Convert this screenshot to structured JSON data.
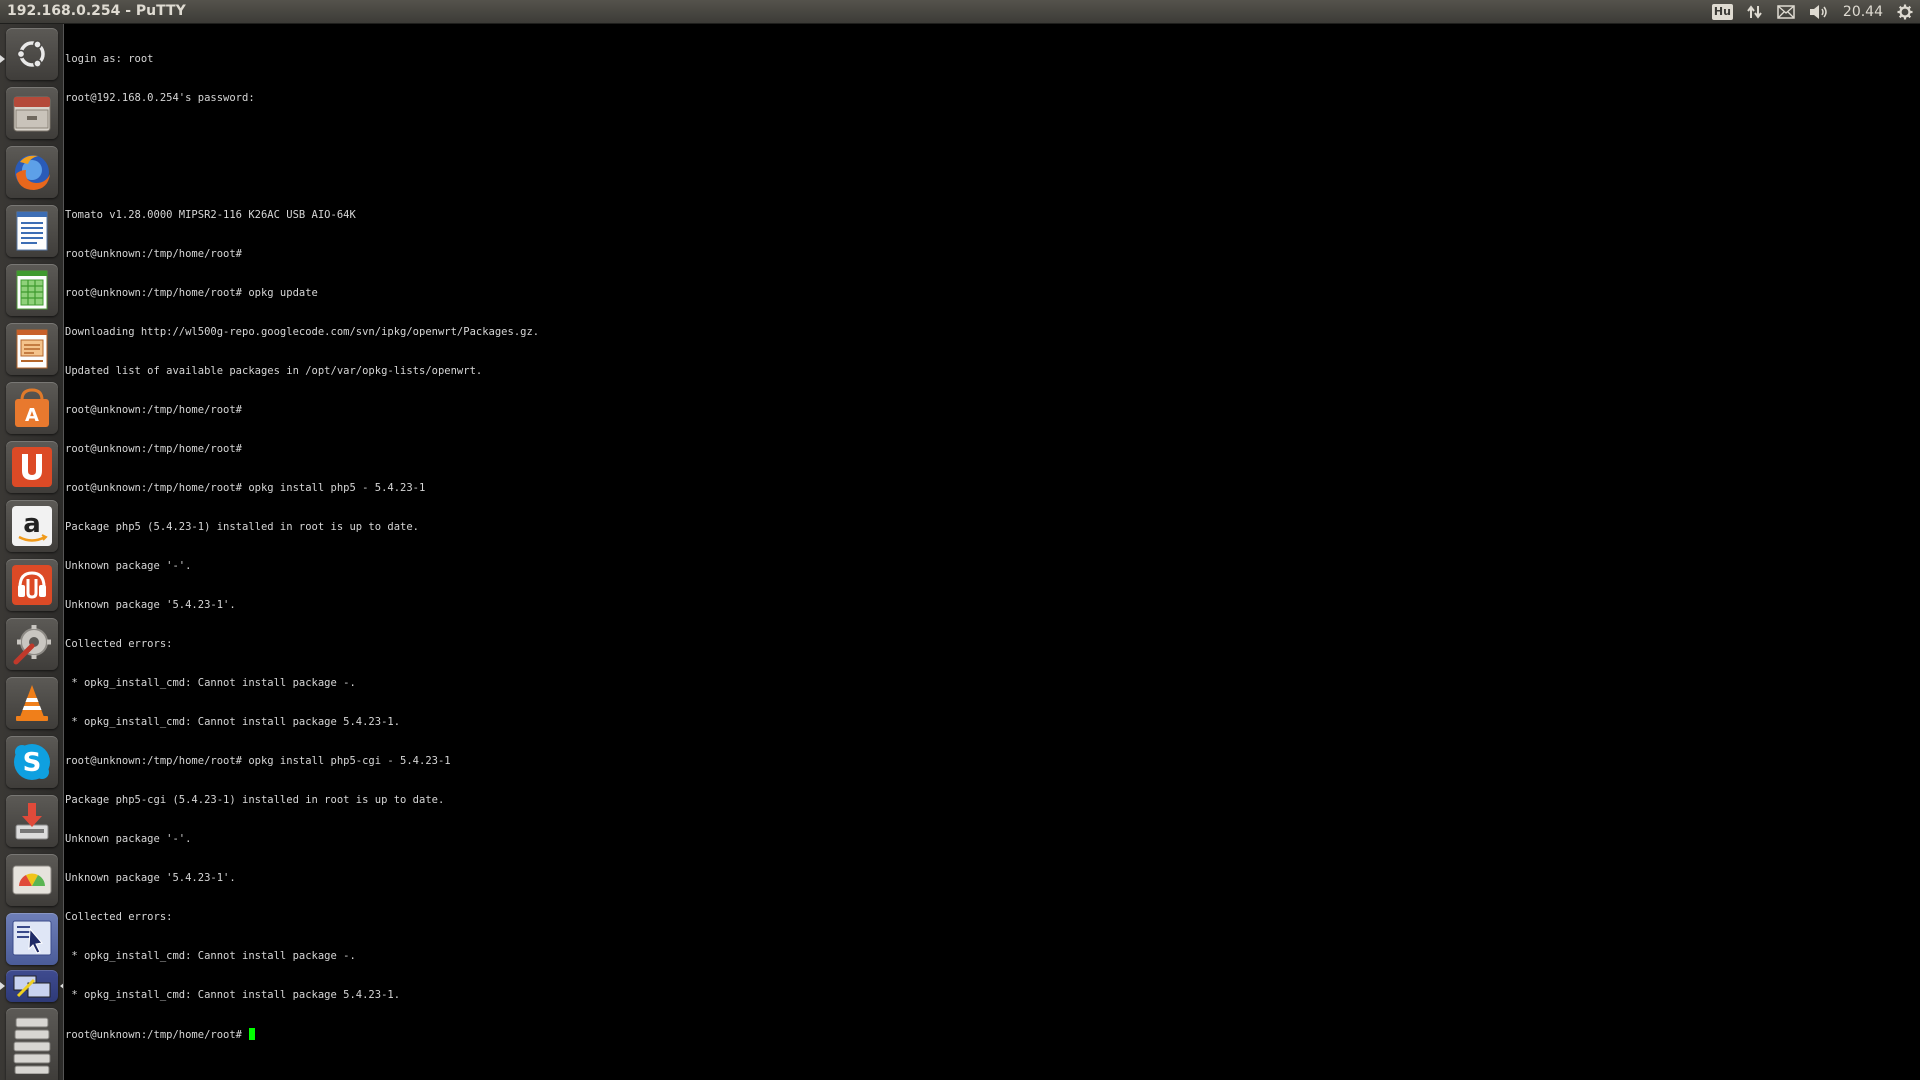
{
  "panel": {
    "window_title": "192.168.0.254 - PuTTY",
    "keyboard_layout": "Hu",
    "clock": "20.44",
    "icons": [
      "network-icon",
      "mail-icon",
      "volume-icon",
      "gear-icon"
    ]
  },
  "launcher": {
    "items": [
      {
        "name": "dash-home",
        "icon": "ubuntu-logo-icon"
      },
      {
        "name": "file-manager",
        "icon": "file-cabinet-icon"
      },
      {
        "name": "firefox",
        "icon": "firefox-icon"
      },
      {
        "name": "writer",
        "icon": "document-icon"
      },
      {
        "name": "calc",
        "icon": "spreadsheet-icon"
      },
      {
        "name": "impress",
        "icon": "presentation-icon"
      },
      {
        "name": "software-center",
        "icon": "shopping-bag-icon"
      },
      {
        "name": "ubuntu-one",
        "icon": "ubuntu-one-icon"
      },
      {
        "name": "amazon",
        "icon": "amazon-icon"
      },
      {
        "name": "ubuntu-one-music",
        "icon": "music-icon"
      },
      {
        "name": "system-settings",
        "icon": "settings-wrench-icon"
      },
      {
        "name": "vlc",
        "icon": "vlc-cone-icon"
      },
      {
        "name": "skype",
        "icon": "skype-icon"
      },
      {
        "name": "install-tool",
        "icon": "download-icon"
      },
      {
        "name": "disk-usage",
        "icon": "disk-chart-icon"
      },
      {
        "name": "workspace-switcher",
        "icon": "workspace-icon"
      },
      {
        "name": "putty",
        "icon": "putty-icon"
      },
      {
        "name": "trash-stack",
        "icon": "stack-icon"
      }
    ]
  },
  "terminal": {
    "lines": [
      "login as: root",
      "root@192.168.0.254's password:",
      "",
      "",
      "Tomato v1.28.0000 MIPSR2-116 K26AC USB AIO-64K",
      "root@unknown:/tmp/home/root#",
      "root@unknown:/tmp/home/root# opkg update",
      "Downloading http://wl500g-repo.googlecode.com/svn/ipkg/openwrt/Packages.gz.",
      "Updated list of available packages in /opt/var/opkg-lists/openwrt.",
      "root@unknown:/tmp/home/root#",
      "root@unknown:/tmp/home/root#",
      "root@unknown:/tmp/home/root# opkg install php5 - 5.4.23-1",
      "Package php5 (5.4.23-1) installed in root is up to date.",
      "Unknown package '-'.",
      "Unknown package '5.4.23-1'.",
      "Collected errors:",
      " * opkg_install_cmd: Cannot install package -.",
      " * opkg_install_cmd: Cannot install package 5.4.23-1.",
      "root@unknown:/tmp/home/root# opkg install php5-cgi - 5.4.23-1",
      "Package php5-cgi (5.4.23-1) installed in root is up to date.",
      "Unknown package '-'.",
      "Unknown package '5.4.23-1'.",
      "Collected errors:",
      " * opkg_install_cmd: Cannot install package -.",
      " * opkg_install_cmd: Cannot install package 5.4.23-1."
    ],
    "prompt": "root@unknown:/tmp/home/root# "
  },
  "colors": {
    "panel_bg": "#3c3b37",
    "terminal_bg": "#000000",
    "terminal_fg": "#d6d6d6",
    "cursor": "#00ff00"
  }
}
